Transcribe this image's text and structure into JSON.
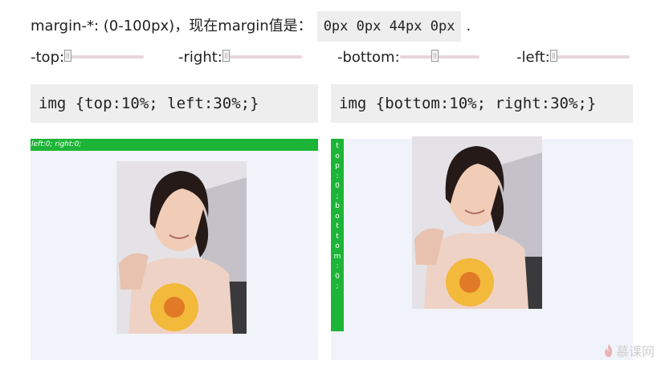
{
  "header": {
    "intro_text": "margin-*: (0-100px)，现在margin值是：",
    "margin_value": "0px 0px 44px 0px",
    "period": "."
  },
  "sliders": [
    {
      "label": "-top:",
      "value": 0,
      "min": 0,
      "max": 100
    },
    {
      "label": "-right:",
      "value": 0,
      "min": 0,
      "max": 100
    },
    {
      "label": "-bottom:",
      "value": 44,
      "min": 0,
      "max": 100
    },
    {
      "label": "-left:",
      "value": 0,
      "min": 0,
      "max": 100
    }
  ],
  "code": {
    "left": "img {top:10%; left:30%;}",
    "right": "img {bottom:10%; right:30%;}"
  },
  "demo": {
    "left_bar_label": "left:0; right:0;",
    "right_bar_label": "top:0;bottom:0;"
  },
  "watermark": "慕课网",
  "colors": {
    "green": "#1db537",
    "demo_bg": "#f0f3fa",
    "code_bg": "#eeeeee",
    "slider_track": "#e6d6dc"
  }
}
